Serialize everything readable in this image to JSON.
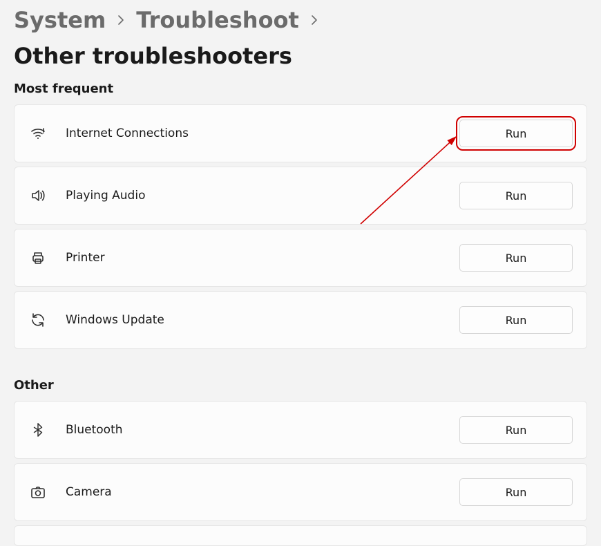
{
  "breadcrumb": {
    "system": "System",
    "troubleshoot": "Troubleshoot",
    "current": "Other troubleshooters"
  },
  "sections": {
    "most_frequent": "Most frequent",
    "other": "Other"
  },
  "items": {
    "internet": {
      "label": "Internet Connections",
      "run": "Run"
    },
    "audio": {
      "label": "Playing Audio",
      "run": "Run"
    },
    "printer": {
      "label": "Printer",
      "run": "Run"
    },
    "update": {
      "label": "Windows Update",
      "run": "Run"
    },
    "bluetooth": {
      "label": "Bluetooth",
      "run": "Run"
    },
    "camera": {
      "label": "Camera",
      "run": "Run"
    }
  },
  "colors": {
    "highlight": "#d00000"
  }
}
